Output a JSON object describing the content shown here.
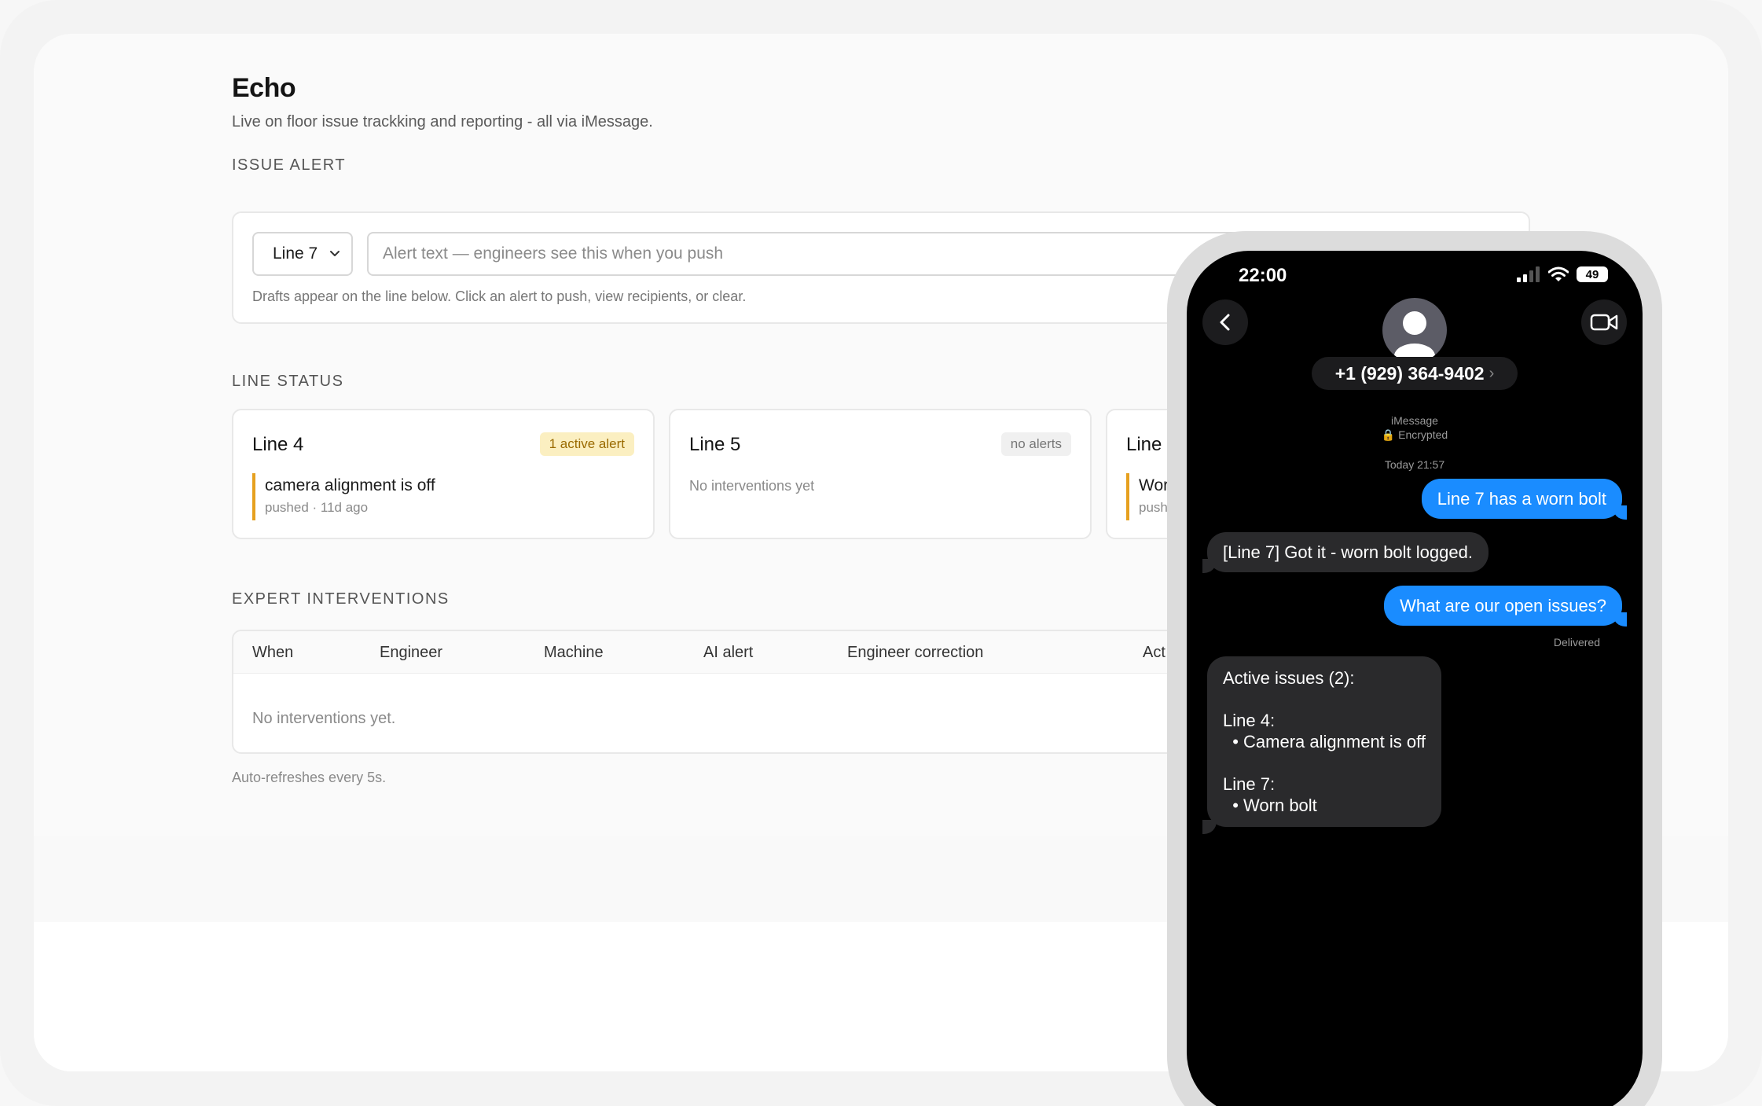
{
  "app": {
    "title": "Echo",
    "subtitle": "Live on floor issue trackking and reporting - all via iMessage."
  },
  "issue_alert": {
    "section_label": "ISSUE ALERT",
    "line_select_value": "Line 7",
    "input_placeholder": "Alert text — engineers see this when you push",
    "hint": "Drafts appear on the line below. Click an alert to push, view recipients, or clear."
  },
  "line_status": {
    "section_label": "LINE STATUS",
    "cards": [
      {
        "name": "Line 4",
        "badge": "1 active alert",
        "issue_title": "camera alignment is off",
        "issue_meta": "pushed · 11d ago"
      },
      {
        "name": "Line 5",
        "badge": "no alerts",
        "empty_note": "No interventions yet"
      },
      {
        "name": "Line",
        "issue_title": "Wor",
        "issue_meta": "push"
      }
    ]
  },
  "expert_interventions": {
    "section_label": "EXPERT INTERVENTIONS",
    "columns": [
      "When",
      "Engineer",
      "Machine",
      "AI alert",
      "Engineer correction",
      "Act"
    ],
    "empty_text": "No interventions yet.",
    "refresh_note": "Auto-refreshes every 5s."
  },
  "phone": {
    "time": "22:00",
    "battery": "49",
    "contact": "+1 (929) 364-9402",
    "service": "iMessage",
    "encryption": "Encrypted",
    "timestamp": "Today 21:57",
    "messages": [
      {
        "direction": "out",
        "text": "Line 7 has a worn bolt"
      },
      {
        "direction": "in",
        "text": "[Line 7] Got it - worn bolt logged."
      },
      {
        "direction": "out",
        "text": "What are our open issues?"
      },
      {
        "direction": "in",
        "text": "Active issues (2):\n\nLine 4:\n  • Camera alignment is off\n\nLine 7:\n  • Worn bolt"
      }
    ],
    "delivered": "Delivered"
  },
  "colors": {
    "accent_blue": "#1a8cff",
    "badge_active_bg": "#fbefc1",
    "badge_active_text": "#9a6a00",
    "issue_bar": "#e6a01f"
  }
}
